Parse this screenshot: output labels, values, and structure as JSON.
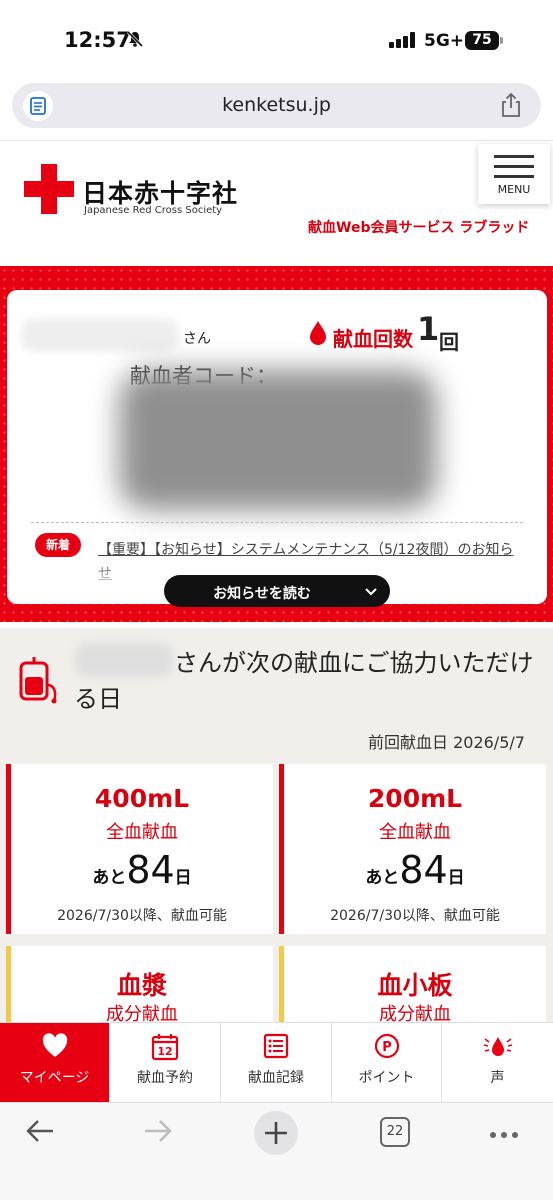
{
  "status_bar": {
    "time": "12:57",
    "network": "5G+",
    "battery": "75"
  },
  "browser": {
    "url": "kenketsu.jp",
    "tab_count": "22"
  },
  "header": {
    "logo_ja": "日本赤十字社",
    "logo_en": "Japanese Red Cross Society",
    "menu_label": "MENU",
    "service_name": "献血Web会員サービス ラブラッド"
  },
  "member": {
    "honorific": "さん",
    "donation_count_label": "献血回数",
    "donation_count": "1",
    "donation_count_unit": "回",
    "donor_code_label": "献血者コード：",
    "news_badge": "新着",
    "news_text": "【重要】【お知らせ】システムメンテナンス（5/12夜間）のお知らせ",
    "read_news_label": "お知らせを読む"
  },
  "next_donation": {
    "title": "さんが次の献血にご協力いただける日",
    "last_donation": "前回献血日 2026/5/7",
    "cards": [
      {
        "volume": "400mL",
        "kind": "全血献血",
        "prefix": "あと",
        "days": "84",
        "suffix": "日",
        "available": "2026/7/30以降、献血可能"
      },
      {
        "volume": "200mL",
        "kind": "全血献血",
        "prefix": "あと",
        "days": "84",
        "suffix": "日",
        "available": "2026/7/30以降、献血可能"
      },
      {
        "volume": "血漿",
        "kind": "成分献血"
      },
      {
        "volume": "血小板",
        "kind": "成分献血"
      }
    ]
  },
  "tabs": [
    {
      "label": "マイページ",
      "icon": "heart-icon"
    },
    {
      "label": "献血予約",
      "icon": "calendar-icon",
      "calendar_day": "12"
    },
    {
      "label": "献血記録",
      "icon": "list-icon"
    },
    {
      "label": "ポイント",
      "icon": "point-icon",
      "point_letter": "P"
    },
    {
      "label": "声",
      "icon": "blood-drop-icon"
    }
  ],
  "colors": {
    "brand_red": "#e60012",
    "text_red": "#d7000f",
    "accent_yellow": "#f3c94a"
  }
}
